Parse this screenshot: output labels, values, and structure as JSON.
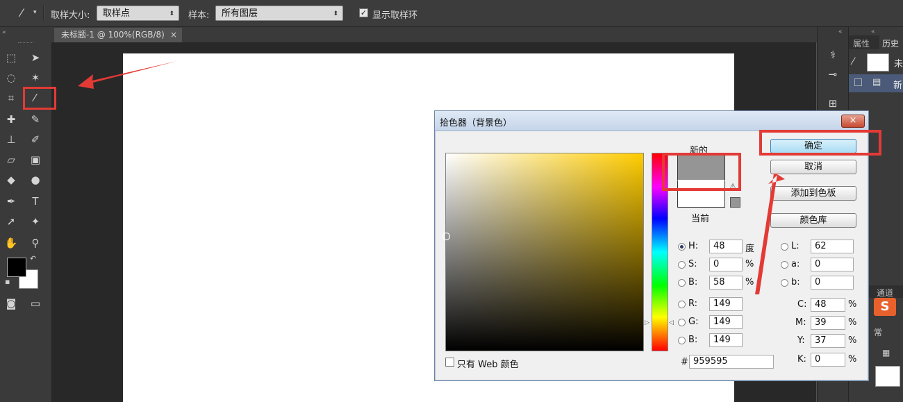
{
  "options_bar": {
    "sample_size_label": "取样大小:",
    "sample_size_value": "取样点",
    "sample_label": "样本:",
    "sample_value": "所有图层",
    "show_ring_label": "显示取样环",
    "show_ring_checked": true
  },
  "document_tab": {
    "title": "未标题-1 @ 100%(RGB/8)",
    "close": "×"
  },
  "right_panel": {
    "tab1": "属性",
    "tab2": "历史",
    "item1": "未",
    "item2": "新",
    "tab3": "通道",
    "text1": "常",
    "logo_text": "S"
  },
  "dialog": {
    "title": "拾色器（背景色）",
    "close": "×",
    "new_label": "新的",
    "current_label": "当前",
    "new_color": "#959595",
    "current_color": "#ffffff",
    "buttons": {
      "ok": "确定",
      "cancel": "取消",
      "add_swatch": "添加到色板",
      "libraries": "颜色库"
    },
    "hsb": {
      "h_label": "H:",
      "h_value": "48",
      "h_unit": "度",
      "s_label": "S:",
      "s_value": "0",
      "s_unit": "%",
      "b_label": "B:",
      "b_value": "58",
      "b_unit": "%"
    },
    "rgb": {
      "r_label": "R:",
      "r_value": "149",
      "g_label": "G:",
      "g_value": "149",
      "b_label": "B:",
      "b_value": "149"
    },
    "lab": {
      "l_label": "L:",
      "l_value": "62",
      "a_label": "a:",
      "a_value": "0",
      "b_label": "b:",
      "b_value": "0"
    },
    "cmyk": {
      "c_label": "C:",
      "c_value": "48",
      "m_label": "M:",
      "m_value": "39",
      "y_label": "Y:",
      "y_value": "37",
      "k_label": "K:",
      "k_value": "0",
      "unit": "%"
    },
    "hex_label": "#",
    "hex_value": "959595",
    "web_only_label": "只有 Web 颜色",
    "web_only_checked": false
  },
  "colors": {
    "annotation_red": "#e33a35",
    "foreground": "#000000",
    "background": "#ffffff"
  }
}
